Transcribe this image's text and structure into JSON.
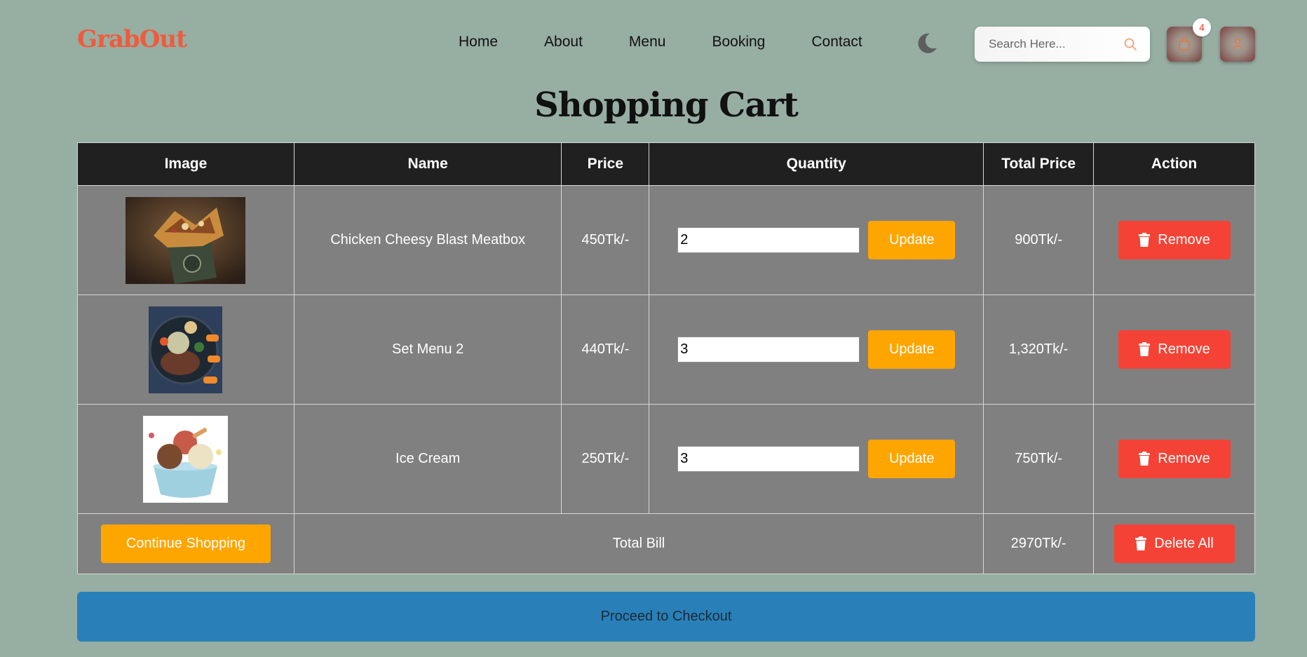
{
  "brand": {
    "name": "GrabOut",
    "color": "#ef5b3c"
  },
  "nav": {
    "items": [
      {
        "label": "Home"
      },
      {
        "label": "About"
      },
      {
        "label": "Menu"
      },
      {
        "label": "Booking"
      },
      {
        "label": "Contact"
      }
    ]
  },
  "search": {
    "placeholder": "Search Here..."
  },
  "cart_badge": {
    "count": "4"
  },
  "page": {
    "title": "Shopping Cart"
  },
  "table": {
    "headers": {
      "image": "Image",
      "name": "Name",
      "price": "Price",
      "quantity": "Quantity",
      "total_price": "Total Price",
      "action": "Action"
    },
    "items": [
      {
        "name": "Chicken Cheesy Blast Meatbox",
        "price": "450Tk/-",
        "quantity": "2",
        "total": "900Tk/-",
        "image_icon": "meatbox-photo"
      },
      {
        "name": "Set Menu 2",
        "price": "440Tk/-",
        "quantity": "3",
        "total": "1,320Tk/-",
        "image_icon": "set-menu-photo"
      },
      {
        "name": "Ice Cream",
        "price": "250Tk/-",
        "quantity": "3",
        "total": "750Tk/-",
        "image_icon": "ice-cream-photo"
      }
    ],
    "update_label": "Update",
    "remove_label": "Remove",
    "footer": {
      "continue_label": "Continue Shopping",
      "total_bill_label": "Total Bill",
      "total_bill_value": "2970Tk/-",
      "delete_all_label": "Delete All"
    }
  },
  "checkout": {
    "label": "Proceed to Checkout"
  },
  "colors": {
    "background": "#97aea3",
    "accent_orange": "#ffa500",
    "danger_red": "#f44336",
    "checkout_blue": "#2980b9",
    "table_header": "#202020",
    "table_cell": "#808080"
  }
}
